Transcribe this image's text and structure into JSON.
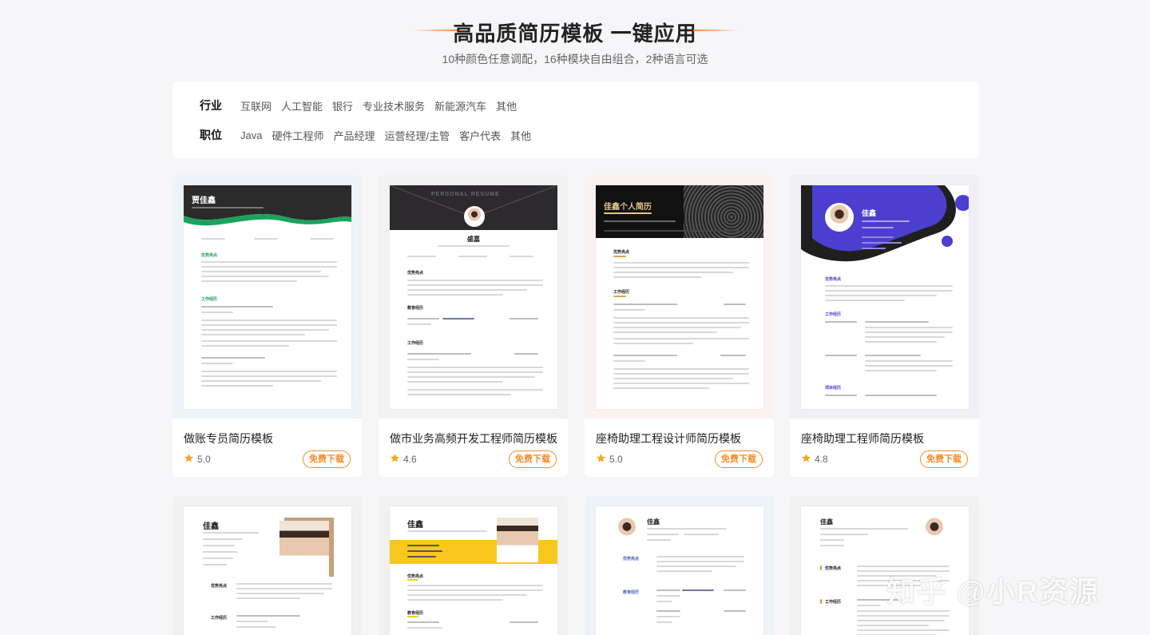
{
  "hero": {
    "title": "高品质简历模板 一键应用",
    "subtitle": "10种颜色任意调配，16种模块自由组合，2种语言可选"
  },
  "filters": {
    "industry_label": "行业",
    "industry_options": [
      "互联网",
      "人工智能",
      "银行",
      "专业技术服务",
      "新能源汽车",
      "其他"
    ],
    "position_label": "职位",
    "position_options": [
      "Java",
      "硬件工程师",
      "产品经理",
      "运营经理/主管",
      "客户代表",
      "其他"
    ]
  },
  "cards": [
    {
      "title": "做账专员简历模板",
      "rating": "5.0",
      "download": "免费下载",
      "preview_name": "贾佳鑫",
      "accent": "#1aa35c"
    },
    {
      "title": "做市业务高频开发工程师简历模板",
      "rating": "4.6",
      "download": "免费下载",
      "preview_name": "盛嘉",
      "accent": "#333333"
    },
    {
      "title": "座椅助理工程设计师简历模板",
      "rating": "5.0",
      "download": "免费下载",
      "preview_name": "佳鑫个人简历",
      "accent": "#111111"
    },
    {
      "title": "座椅助理工程师简历模板",
      "rating": "4.8",
      "download": "免费下载",
      "preview_name": "佳鑫",
      "accent": "#4a3fcf"
    }
  ],
  "bottom_cards": [
    {
      "preview_name": "佳鑫",
      "accent": "#c8a07a"
    },
    {
      "preview_name": "佳鑫",
      "accent": "#f9c81e"
    },
    {
      "preview_name": "佳鑫",
      "accent": "#4a5fc1"
    },
    {
      "preview_name": "佳鑫",
      "accent": "#f28c28"
    }
  ],
  "preview_text": {
    "advantage": "优势亮点",
    "work": "工作经历",
    "education": "教育经历",
    "project": "项目经历",
    "personal_resume": "PERSONAL RESUME"
  },
  "watermark": "知乎 @小R资源",
  "colors": {
    "accent": "#f28c28",
    "star": "#f5a623"
  }
}
